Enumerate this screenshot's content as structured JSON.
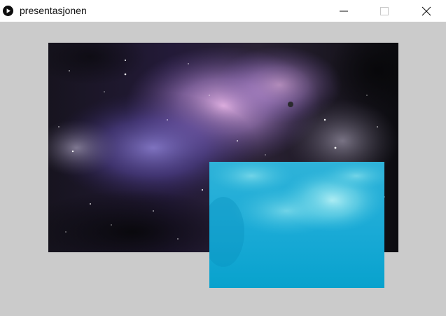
{
  "window": {
    "title": "presentasjonen",
    "app_icon": "play-circle-icon",
    "controls": [
      "minimize-icon",
      "maximize-icon",
      "close-icon"
    ]
  },
  "canvas": {
    "background": "#cbcbcb",
    "images": [
      {
        "name": "space-nebula-image",
        "colors": [
          "#1c1628",
          "#6a5aa8",
          "#c99ad6",
          "#0b0b10"
        ]
      },
      {
        "name": "underwater-image",
        "colors": [
          "#19a9d6",
          "#8fe3ee",
          "#0b9fcc"
        ]
      }
    ]
  }
}
